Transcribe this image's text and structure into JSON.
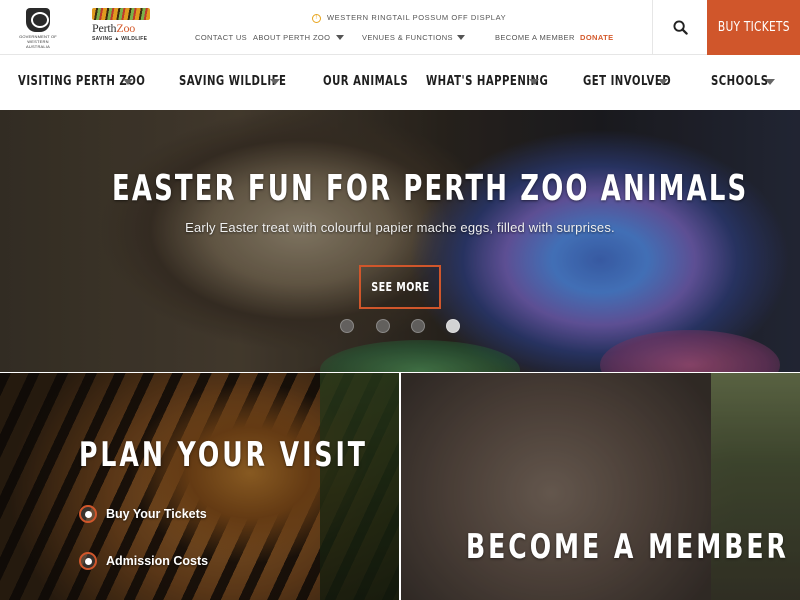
{
  "brand": {
    "gov_logo_text": "GOVERNMENT OF WESTERN AUSTRALIA",
    "zoo_name_1": "Perth",
    "zoo_name_2": "Zoo",
    "zoo_tagline": "SAVING ▲ WILDLIFE"
  },
  "alert": {
    "icon": "info-icon",
    "text": "WESTERN RINGTAIL POSSUM OFF DISPLAY"
  },
  "utility_nav": [
    {
      "label": "CONTACT US"
    },
    {
      "label": "ABOUT PERTH ZOO"
    },
    {
      "label": "VENUES & FUNCTIONS"
    },
    {
      "label": "BECOME A MEMBER"
    },
    {
      "label": "DONATE"
    }
  ],
  "header": {
    "search_icon": "search-icon",
    "buy_tickets": "BUY TICKETS",
    "accent": "#d0562b"
  },
  "main_nav": [
    {
      "label": "VISITING PERTH ZOO",
      "has_dropdown": true
    },
    {
      "label": "SAVING WILDLIFE",
      "has_dropdown": true
    },
    {
      "label": "OUR ANIMALS",
      "has_dropdown": false
    },
    {
      "label": "WHAT'S HAPPENING",
      "has_dropdown": true
    },
    {
      "label": "GET INVOLVED",
      "has_dropdown": true
    },
    {
      "label": "SCHOOLS",
      "has_dropdown": true
    }
  ],
  "hero": {
    "title": "EASTER FUN FOR PERTH ZOO ANIMALS",
    "subtitle": "Early Easter treat with colourful papier mache eggs, filled with surprises.",
    "cta": "SEE MORE",
    "slide_count": 4,
    "active_slide": 4
  },
  "tiles": {
    "plan": {
      "title": "PLAN YOUR VISIT",
      "links": [
        {
          "label": "Buy Your Tickets",
          "icon": "paw-icon"
        },
        {
          "label": "Admission Costs",
          "icon": "paw-icon"
        }
      ]
    },
    "member": {
      "title": "BECOME A MEMBER"
    }
  }
}
